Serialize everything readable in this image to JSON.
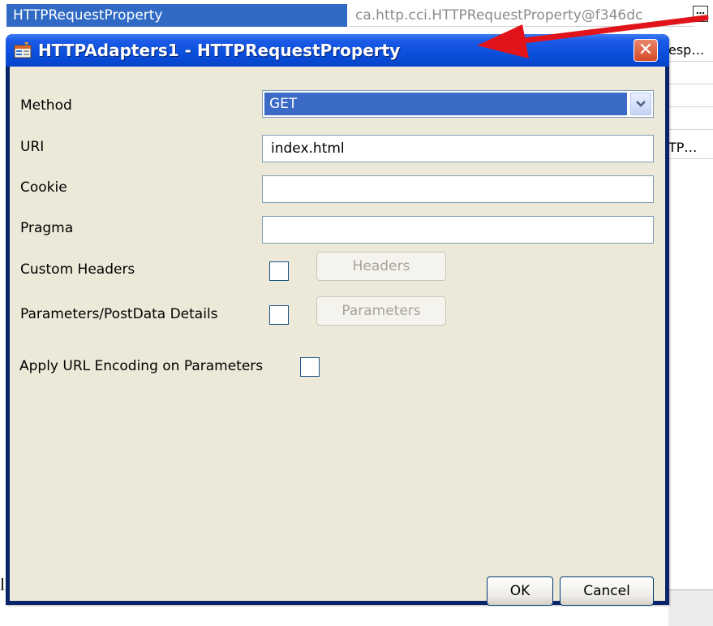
{
  "background": {
    "selected_property_name": "HTTPRequestProperty",
    "selected_property_value": "ca.http.cci.HTTPRequestProperty@f346dc",
    "ellipsis_label": "…",
    "clipped_cell_1": "esp…",
    "clipped_cell_2": "TP…",
    "clipped_left_char": "I"
  },
  "dialog": {
    "title": "HTTPAdapters1 - HTTPRequestProperty",
    "close_label": "✕",
    "fields": {
      "method_label": "Method",
      "method_value": "GET",
      "uri_label": "URI",
      "uri_value": "index.html",
      "cookie_label": "Cookie",
      "cookie_value": "",
      "pragma_label": "Pragma",
      "pragma_value": ""
    },
    "custom_headers_label": "Custom Headers",
    "headers_button": "Headers",
    "parameters_label": "Parameters/PostData Details",
    "parameters_button": "Parameters",
    "url_encoding_label": "Apply URL Encoding on Parameters",
    "ok_button": "OK",
    "cancel_button": "Cancel",
    "checkboxes": {
      "custom_headers": false,
      "parameters": false,
      "url_encoding": false
    }
  },
  "colors": {
    "title_bar": "#0a4fdc",
    "selection": "#316ac5",
    "dialog_face": "#ece9d8",
    "arrow": "#e0141a"
  },
  "icons": {
    "title": "property-editor-icon",
    "dropdown": "chevron-down-icon",
    "close": "close-icon"
  }
}
